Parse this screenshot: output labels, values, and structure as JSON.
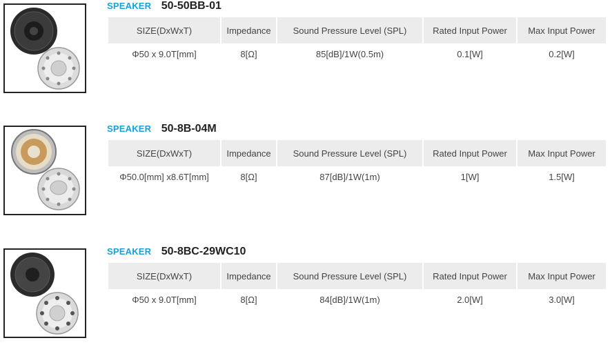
{
  "columns": [
    "SIZE(DxWxT)",
    "Impedance",
    "Sound Pressure Level (SPL)",
    "Rated Input Power",
    "Max Input Power"
  ],
  "products": [
    {
      "tag": "SPEAKER",
      "model": "50-50BB-01",
      "row": [
        "Φ50 x 9.0T[mm]",
        "8[Ω]",
        "85[dB]/1W(0.5m)",
        "0.1[W]",
        "0.2[W]"
      ]
    },
    {
      "tag": "SPEAKER",
      "model": "50-8B-04M",
      "row": [
        "Φ50.0[mm] x8.6T[mm]",
        "8[Ω]",
        "87[dB]/1W(1m)",
        "1[W]",
        "1.5[W]"
      ]
    },
    {
      "tag": "SPEAKER",
      "model": "50-8BC-29WC10",
      "row": [
        "Φ50 x 9.0T[mm]",
        "8[Ω]",
        "84[dB]/1W(1m)",
        "2.0[W]",
        "3.0[W]"
      ]
    }
  ]
}
